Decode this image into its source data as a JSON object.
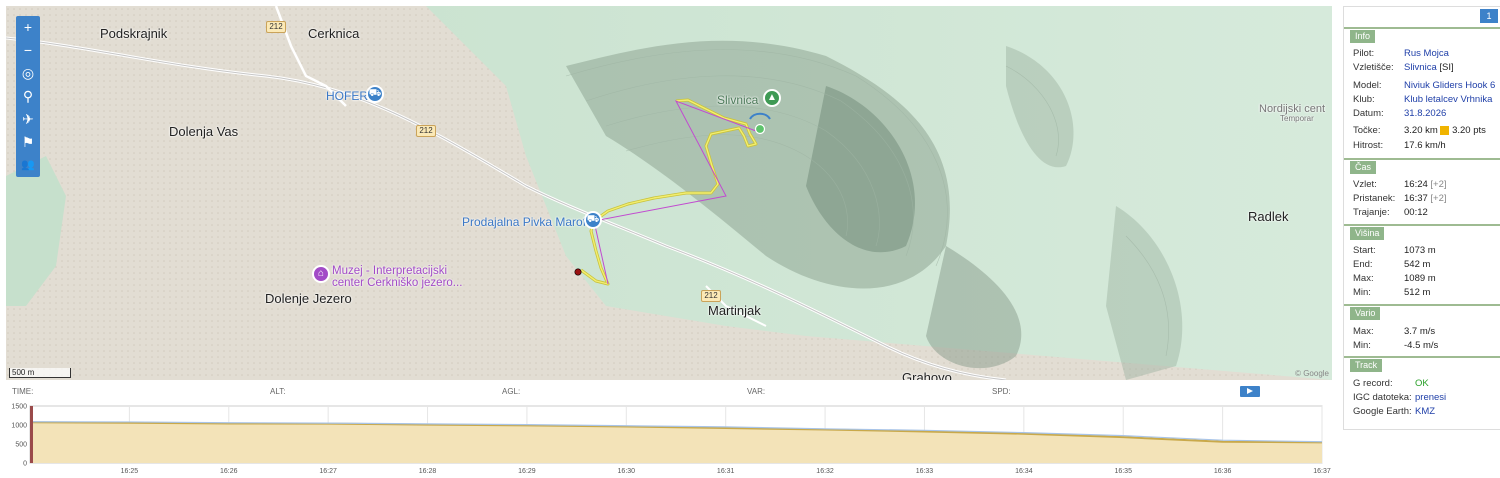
{
  "map": {
    "places": {
      "podskrajnik": "Podskrajnik",
      "cerknica": "Cerknica",
      "hofer": "HOFER",
      "dolenja_vas": "Dolenja Vas",
      "prodajalna": "Prodajalna Pivka Marof",
      "muzej_line1": "Muzej - Interpretacijski",
      "muzej_line2": "center Cerkniško jezero...",
      "dolenje_jezero": "Dolenje Jezero",
      "slivnica": "Slivnica",
      "martinjak": "Martinjak",
      "radlek": "Radlek",
      "nordijski": "Nordijski cent",
      "temporarily": "Temporar",
      "grahovo": "Grahovo"
    },
    "road_number": "212",
    "scale_label": "500 m",
    "attribution": "© Google",
    "toolbar_icons": [
      "zoom-in-icon",
      "zoom-out-icon",
      "target-icon",
      "pin-icon",
      "plane-icon",
      "flag-icon",
      "group-icon"
    ],
    "toolbar_glyphs": [
      "+",
      "−",
      "◎",
      "⚲",
      "✈",
      "⚑",
      "👥"
    ]
  },
  "panel": {
    "page": "1",
    "info": {
      "title": "Info",
      "pilot_k": "Pilot:",
      "pilot_v": "Rus Mojca",
      "site_k": "Vzletišče:",
      "site_v": "Slivnica",
      "site_suffix": " [SI]",
      "model_k": "Model:",
      "model_v": "Niviuk Gliders Hook 6",
      "club_k": "Klub:",
      "club_v": "Klub letalcev Vrhnika",
      "date_k": "Datum:",
      "date_v": "31.8.2026",
      "points_k": "Točke:",
      "points_km": "3.20 km",
      "points_pts": "3.20 pts",
      "speed_k": "Hitrost:",
      "speed_v": "17.6 km/h"
    },
    "time": {
      "title": "Čas",
      "takeoff_k": "Vzlet:",
      "takeoff_v": "16:24",
      "takeoff_tz": "[+2]",
      "landing_k": "Pristanek:",
      "landing_v": "16:37",
      "landing_tz": "[+2]",
      "duration_k": "Trajanje:",
      "duration_v": "00:12"
    },
    "altitude": {
      "title": "Višina",
      "start_k": "Start:",
      "start_v": "1073 m",
      "end_k": "End:",
      "end_v": "542 m",
      "max_k": "Max:",
      "max_v": "1089 m",
      "min_k": "Min:",
      "min_v": "512 m"
    },
    "vario": {
      "title": "Vario",
      "max_k": "Max:",
      "max_v": "3.7 m/s",
      "min_k": "Min:",
      "min_v": "-4.5 m/s"
    },
    "track": {
      "title": "Track",
      "grecord_k": "G record:",
      "grecord_v": "OK",
      "igc_k": "IGC datoteka:",
      "igc_v": "prenesi",
      "ge_k": "Google Earth:",
      "ge_v": "KMZ"
    }
  },
  "chart_head": {
    "time": "TIME:",
    "alt": "ALT:",
    "agl": "AGL:",
    "var": "VAR:",
    "spd": "SPD:"
  },
  "chart_data": {
    "type": "area",
    "x": [
      "16:24",
      "16:25",
      "16:26",
      "16:27",
      "16:28",
      "16:29",
      "16:30",
      "16:31",
      "16:32",
      "16:33",
      "16:34",
      "16:35",
      "16:36",
      "16:37"
    ],
    "series": [
      {
        "values": [
          1073,
          1060,
          1040,
          1035,
          1010,
          990,
          960,
          920,
          880,
          830,
          770,
          680,
          560,
          542
        ],
        "color": "#c9a94a"
      },
      {
        "values": [
          1085,
          1080,
          1060,
          1050,
          1030,
          1010,
          980,
          950,
          900,
          860,
          800,
          720,
          600,
          560
        ],
        "color": "#a8c4e8"
      }
    ],
    "y_ticks": [
      "1500",
      "1000",
      "500",
      "0"
    ],
    "ylim": [
      0,
      1500
    ],
    "x_ticks": [
      "16:25",
      "16:26",
      "16:27",
      "16:28",
      "16:29",
      "16:30",
      "16:31",
      "16:32",
      "16:33",
      "16:34",
      "16:35",
      "16:36",
      "16:37"
    ]
  },
  "colors": {
    "accent": "#3d82c9",
    "section": "#8fb58a",
    "track": "#d9d43a",
    "link": "#1f3fa8"
  }
}
